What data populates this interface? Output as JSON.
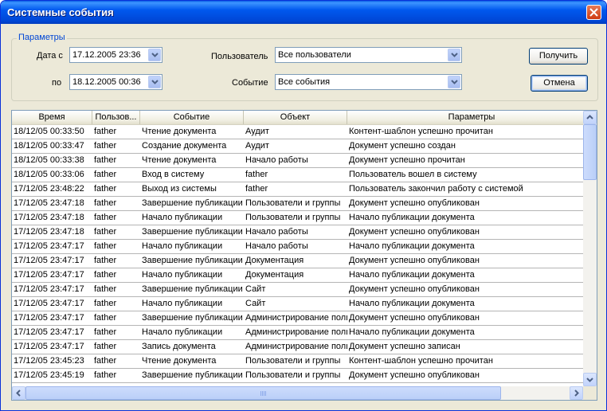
{
  "window": {
    "title": "Системные события"
  },
  "params": {
    "legend": "Параметры",
    "date_from_label": "Дата с",
    "date_from_value": "17.12.2005 23:36",
    "date_to_label": "по",
    "date_to_value": "18.12.2005 00:36",
    "user_label": "Пользователь",
    "user_value": "Все пользователи",
    "event_label": "Событие",
    "event_value": "Все события",
    "get_button": "Получить",
    "cancel_button": "Отмена"
  },
  "table": {
    "columns": [
      "Время",
      "Пользов...",
      "Событие",
      "Объект",
      "Параметры"
    ],
    "rows": [
      [
        "18/12/05 00:33:50",
        "father",
        "Чтение документа",
        "Аудит",
        "Контент-шаблон успешно прочитан"
      ],
      [
        "18/12/05 00:33:47",
        "father",
        "Создание документа",
        "Аудит",
        "Документ успешно создан"
      ],
      [
        "18/12/05 00:33:38",
        "father",
        "Чтение документа",
        "Начало работы",
        "Документ успешно прочитан"
      ],
      [
        "18/12/05 00:33:06",
        "father",
        "Вход в систему",
        "father",
        "Пользователь вошел в систему"
      ],
      [
        "17/12/05 23:48:22",
        "father",
        "Выход из системы",
        "father",
        "Пользователь закончил работу с системой"
      ],
      [
        "17/12/05 23:47:18",
        "father",
        "Завершение публикации",
        "Пользователи и группы",
        "Документ успешно опубликован"
      ],
      [
        "17/12/05 23:47:18",
        "father",
        "Начало публикации",
        "Пользователи и группы",
        "Начало публикации документа"
      ],
      [
        "17/12/05 23:47:18",
        "father",
        "Завершение публикации",
        "Начало работы",
        "Документ успешно опубликован"
      ],
      [
        "17/12/05 23:47:17",
        "father",
        "Начало публикации",
        "Начало работы",
        "Начало публикации документа"
      ],
      [
        "17/12/05 23:47:17",
        "father",
        "Завершение публикации",
        "Документация",
        "Документ успешно опубликован"
      ],
      [
        "17/12/05 23:47:17",
        "father",
        "Начало публикации",
        "Документация",
        "Начало публикации документа"
      ],
      [
        "17/12/05 23:47:17",
        "father",
        "Завершение публикации",
        "Сайт",
        "Документ успешно опубликован"
      ],
      [
        "17/12/05 23:47:17",
        "father",
        "Начало публикации",
        "Сайт",
        "Начало публикации документа"
      ],
      [
        "17/12/05 23:47:17",
        "father",
        "Завершение публикации",
        "Администрирование поли",
        "Документ успешно опубликован"
      ],
      [
        "17/12/05 23:47:17",
        "father",
        "Начало публикации",
        "Администрирование поли",
        "Начало публикации документа"
      ],
      [
        "17/12/05 23:47:17",
        "father",
        "Запись документа",
        "Администрирование поли",
        "Документ успешно записан"
      ],
      [
        "17/12/05 23:45:23",
        "father",
        "Чтение документа",
        "Пользователи и группы",
        "Контент-шаблон успешно прочитан"
      ],
      [
        "17/12/05 23:45:19",
        "father",
        "Завершение публикации",
        "Пользователи и группы",
        "Документ успешно опубликован"
      ]
    ]
  }
}
